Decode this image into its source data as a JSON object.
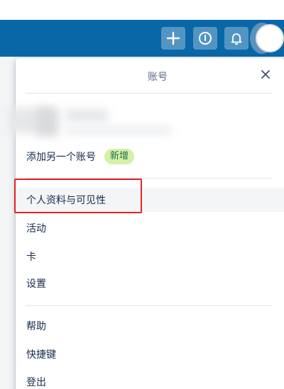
{
  "header": {
    "buttons": {
      "create": {
        "icon": "plus-icon"
      },
      "info": {
        "icon": "info-icon"
      },
      "notifications": {
        "icon": "bell-icon"
      }
    },
    "accent_color": "#0967a8"
  },
  "panel": {
    "title": "账号",
    "close_icon": "close-icon",
    "add_account_label": "添加另一个账号",
    "add_account_badge": "新增",
    "badge_color": "#d3f1a7",
    "menu_group1": [
      {
        "label": "个人资料与可见性"
      },
      {
        "label": "活动"
      },
      {
        "label": "卡"
      },
      {
        "label": "设置"
      }
    ],
    "menu_group2": [
      {
        "label": "帮助"
      },
      {
        "label": "快捷键"
      },
      {
        "label": "登出"
      }
    ],
    "highlight_color": "#e02424"
  }
}
